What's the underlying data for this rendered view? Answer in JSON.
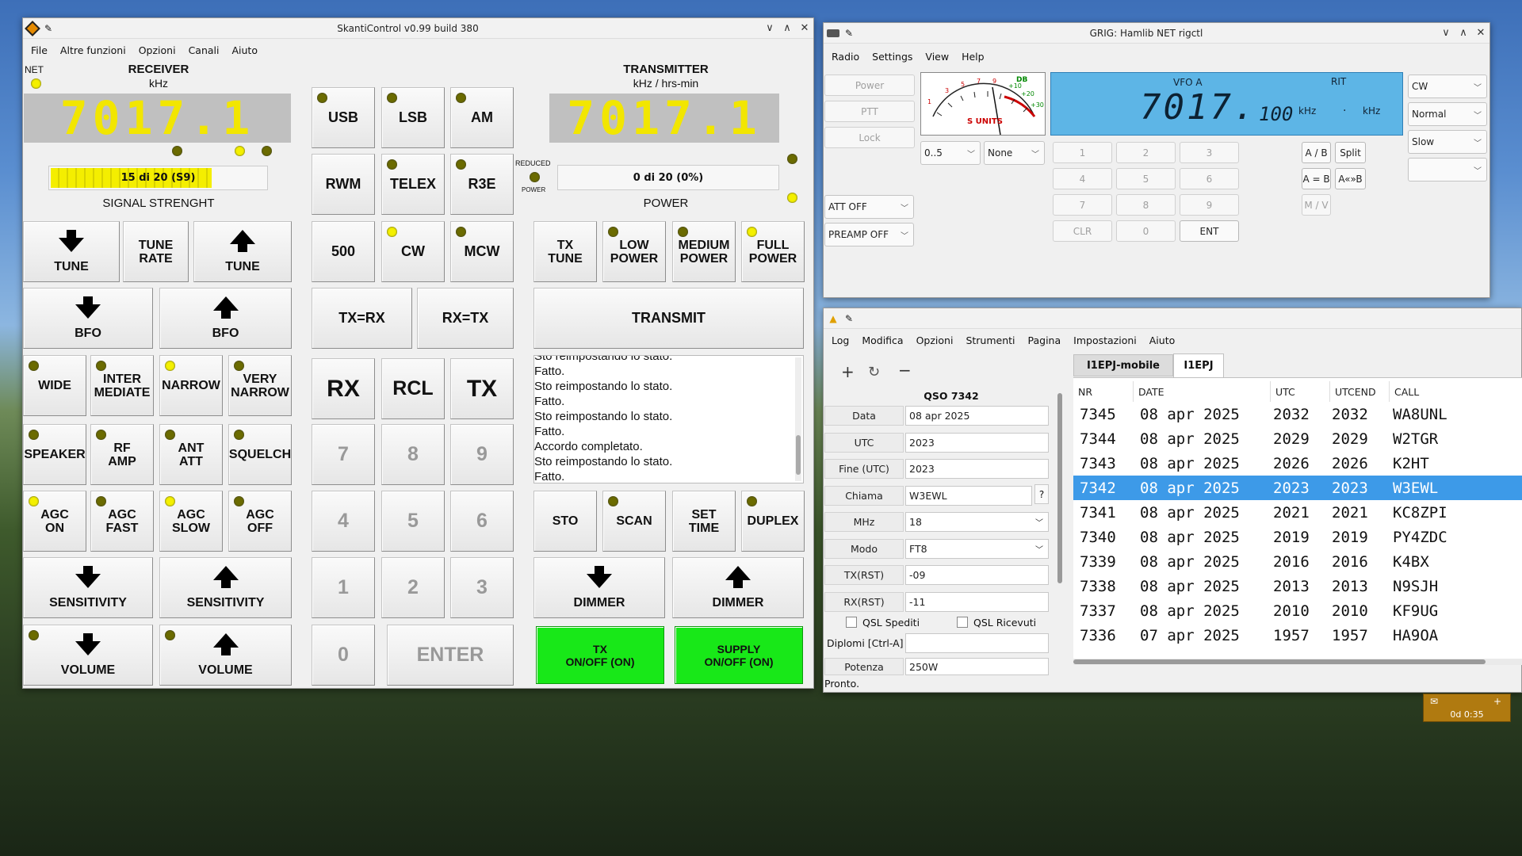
{
  "skanti": {
    "title": "SkantiControl v0.99 build 380",
    "menu": [
      "File",
      "Altre funzioni",
      "Opzioni",
      "Canali",
      "Aiuto"
    ],
    "net_label": "NET",
    "receiver_label": "RECEIVER",
    "receiver_unit": "kHz",
    "rx_freq": "7017.1",
    "transmitter_label": "TRANSMITTER",
    "transmitter_unit": "kHz / hrs-min",
    "tx_freq": "7017.1",
    "signal_text": "15 di 20 (S9)",
    "signal_fraction": 0.75,
    "signal_label": "SIGNAL STRENGHT",
    "reduced_label": "REDUCED",
    "power_small": "POWER",
    "power_text": "0 di 20 (0%)",
    "power_label": "POWER",
    "tune": "TUNE",
    "tune_rate": [
      "TUNE",
      "RATE"
    ],
    "bfo": "BFO",
    "wide": "WIDE",
    "intermediate": [
      "INTER",
      "MEDIATE"
    ],
    "narrow": "NARROW",
    "very_narrow": [
      "VERY",
      "NARROW"
    ],
    "speaker": "SPEAKER",
    "rf_amp": [
      "RF",
      "AMP"
    ],
    "ant_att": [
      "ANT",
      "ATT"
    ],
    "squelch": "SQUELCH",
    "agc_on": [
      "AGC",
      "ON"
    ],
    "agc_fast": [
      "AGC",
      "FAST"
    ],
    "agc_slow": [
      "AGC",
      "SLOW"
    ],
    "agc_off": [
      "AGC",
      "OFF"
    ],
    "sensitivity": "SENSITIVITY",
    "volume": "VOLUME",
    "modes": [
      "USB",
      "LSB",
      "AM",
      "RWM",
      "TELEX",
      "R3E",
      "500",
      "CW",
      "MCW"
    ],
    "tx_rx": "TX=RX",
    "rx_tx": "RX=TX",
    "rx": "RX",
    "rcl": "RCL",
    "tx": "TX",
    "keys": [
      "7",
      "8",
      "9",
      "4",
      "5",
      "6",
      "1",
      "2",
      "3",
      "0"
    ],
    "enter": "ENTER",
    "tx_tune": [
      "TX",
      "TUNE"
    ],
    "low_power": [
      "LOW",
      "POWER"
    ],
    "medium_power": [
      "MEDIUM",
      "POWER"
    ],
    "full_power": [
      "FULL",
      "POWER"
    ],
    "transmit": "TRANSMIT",
    "log_lines": [
      "Sto reimpostando lo stato.",
      "Fatto.",
      "Sto reimpostando lo stato.",
      "Fatto.",
      "Sto reimpostando lo stato.",
      "Fatto.",
      "Accordo completato.",
      "Sto reimpostando lo stato.",
      "Fatto."
    ],
    "sto": "STO",
    "scan": "SCAN",
    "set_time": [
      "SET",
      "TIME"
    ],
    "duplex": "DUPLEX",
    "dimmer": "DIMMER",
    "tx_onoff": [
      "TX",
      "ON/OFF (ON)"
    ],
    "supply_onoff": [
      "SUPPLY",
      "ON/OFF (ON)"
    ]
  },
  "grig": {
    "title": "GRIG: Hamlib NET rigctl",
    "menu": [
      "Radio",
      "Settings",
      "View",
      "Help"
    ],
    "power": "Power",
    "ptt": "PTT",
    "lock": "Lock",
    "meter_label": "S UNITS",
    "meter_db": "DB",
    "meter_ticks": [
      "1",
      "3",
      "5",
      "7",
      "9",
      "+10",
      "+20",
      "+30"
    ],
    "sel_range": "0..5",
    "sel_none": "None",
    "att_off": "ATT OFF",
    "preamp_off": "PREAMP OFF",
    "vfo_label": "VFO A",
    "rit_label": "RIT",
    "vfo_freq_big": "7017.",
    "vfo_freq_small": "100",
    "khz": "kHz",
    "rit_value": ".",
    "keypad": [
      "1",
      "2",
      "3",
      "4",
      "5",
      "6",
      "7",
      "8",
      "9",
      "CLR",
      "0",
      "ENT"
    ],
    "ab": "A / B",
    "split": "Split",
    "a_eq_b": "A = B",
    "a_swap_b": "A«»B",
    "mv": "M / V",
    "mode": "CW",
    "filter": "Normal",
    "agc": "Slow"
  },
  "log": {
    "menu": [
      "Log",
      "Modifica",
      "Opzioni",
      "Strumenti",
      "Pagina",
      "Impostazioni",
      "Aiuto"
    ],
    "qso_title": "QSO 7342",
    "fields": [
      {
        "label": "Data",
        "value": "08 apr 2025"
      },
      {
        "label": "UTC",
        "value": "2023"
      },
      {
        "label": "Fine (UTC)",
        "value": "2023"
      },
      {
        "label": "Chiama",
        "value": "W3EWL"
      },
      {
        "label": "MHz",
        "value": "18"
      },
      {
        "label": "Modo",
        "value": "FT8"
      },
      {
        "label": "TX(RST)",
        "value": "-09"
      },
      {
        "label": "RX(RST)",
        "value": "-11"
      }
    ],
    "help_btn": "?",
    "qsl_sent": "QSL Spediti",
    "qsl_recv": "QSL Ricevuti",
    "diplomi": "Diplomi [Ctrl-A]",
    "potenza_label": "Potenza",
    "potenza": "250W",
    "tabs": [
      "I1EPJ-mobile",
      "I1EPJ"
    ],
    "headers": [
      "NR",
      "DATE",
      "UTC",
      "UTCEND",
      "CALL"
    ],
    "rows": [
      [
        "7345",
        "08 apr 2025",
        "2032",
        "2032",
        "WA8UNL"
      ],
      [
        "7344",
        "08 apr 2025",
        "2029",
        "2029",
        "W2TGR"
      ],
      [
        "7343",
        "08 apr 2025",
        "2026",
        "2026",
        "K2HT"
      ],
      [
        "7342",
        "08 apr 2025",
        "2023",
        "2023",
        "W3EWL"
      ],
      [
        "7341",
        "08 apr 2025",
        "2021",
        "2021",
        "KC8ZPI"
      ],
      [
        "7340",
        "08 apr 2025",
        "2019",
        "2019",
        "PY4ZDC"
      ],
      [
        "7339",
        "08 apr 2025",
        "2016",
        "2016",
        "K4BX"
      ],
      [
        "7338",
        "08 apr 2025",
        "2013",
        "2013",
        "N9SJH"
      ],
      [
        "7337",
        "08 apr 2025",
        "2010",
        "2010",
        "KF9UG"
      ],
      [
        "7336",
        "07 apr 2025",
        "1957",
        "1957",
        "HA9OA"
      ]
    ],
    "status": "Pronto."
  },
  "tray": {
    "clock": "0d 0:35"
  }
}
